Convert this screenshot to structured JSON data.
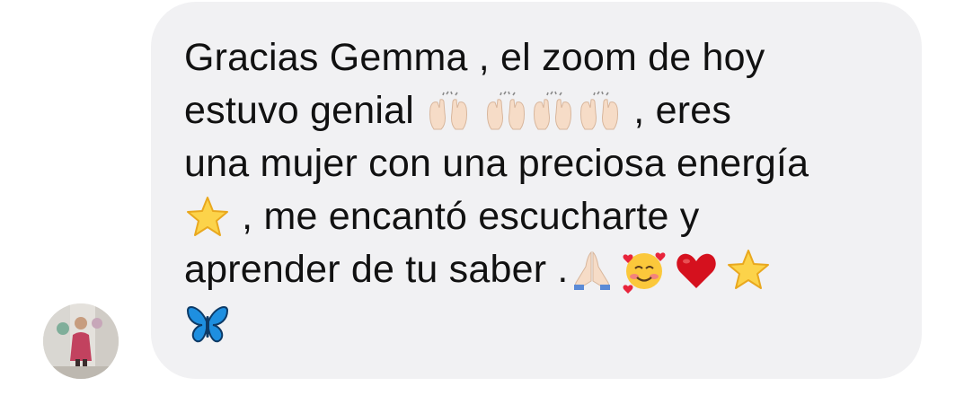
{
  "message": {
    "segments": [
      {
        "type": "text",
        "text": "Gracias Gemma , el zoom de hoy",
        "line": 1
      },
      {
        "type": "text",
        "text": "estuvo genial ",
        "line": 2
      },
      {
        "type": "emoji",
        "icon": "raising-hands-icon",
        "line": 2
      },
      {
        "type": "emoji",
        "icon": "raising-hands-icon",
        "line": 2
      },
      {
        "type": "emoji",
        "icon": "raising-hands-icon",
        "line": 2
      },
      {
        "type": "emoji",
        "icon": "raising-hands-icon",
        "line": 2
      },
      {
        "type": "text",
        "text": " , eres",
        "line": 2
      },
      {
        "type": "text",
        "text": "una mujer con una preciosa energía",
        "line": 3
      },
      {
        "type": "emoji",
        "icon": "star-icon",
        "line": 4
      },
      {
        "type": "text",
        "text": " , me encantó escucharte y",
        "line": 4
      },
      {
        "type": "text",
        "text": "aprender de tu saber .",
        "line": 5
      },
      {
        "type": "emoji",
        "icon": "folded-hands-icon",
        "line": 5
      },
      {
        "type": "emoji",
        "icon": "smiling-face-with-hearts-icon",
        "line": 5
      },
      {
        "type": "emoji",
        "icon": "red-heart-icon",
        "line": 5
      },
      {
        "type": "emoji",
        "icon": "star-icon",
        "line": 5
      },
      {
        "type": "emoji",
        "icon": "butterfly-icon",
        "line": 6
      }
    ],
    "text_line1": "Gracias Gemma , el zoom de hoy",
    "text_line2a": "estuvo genial ",
    "text_line2b": " , eres",
    "text_line3": "una mujer con una preciosa energía",
    "text_line4": " , me encantó escucharte y",
    "text_line5": "aprender de tu saber ."
  },
  "colors": {
    "bubble": "#f1f1f3",
    "text": "#111111",
    "background": "#ffffff"
  },
  "avatar": {
    "icon": "profile-photo-avatar"
  }
}
